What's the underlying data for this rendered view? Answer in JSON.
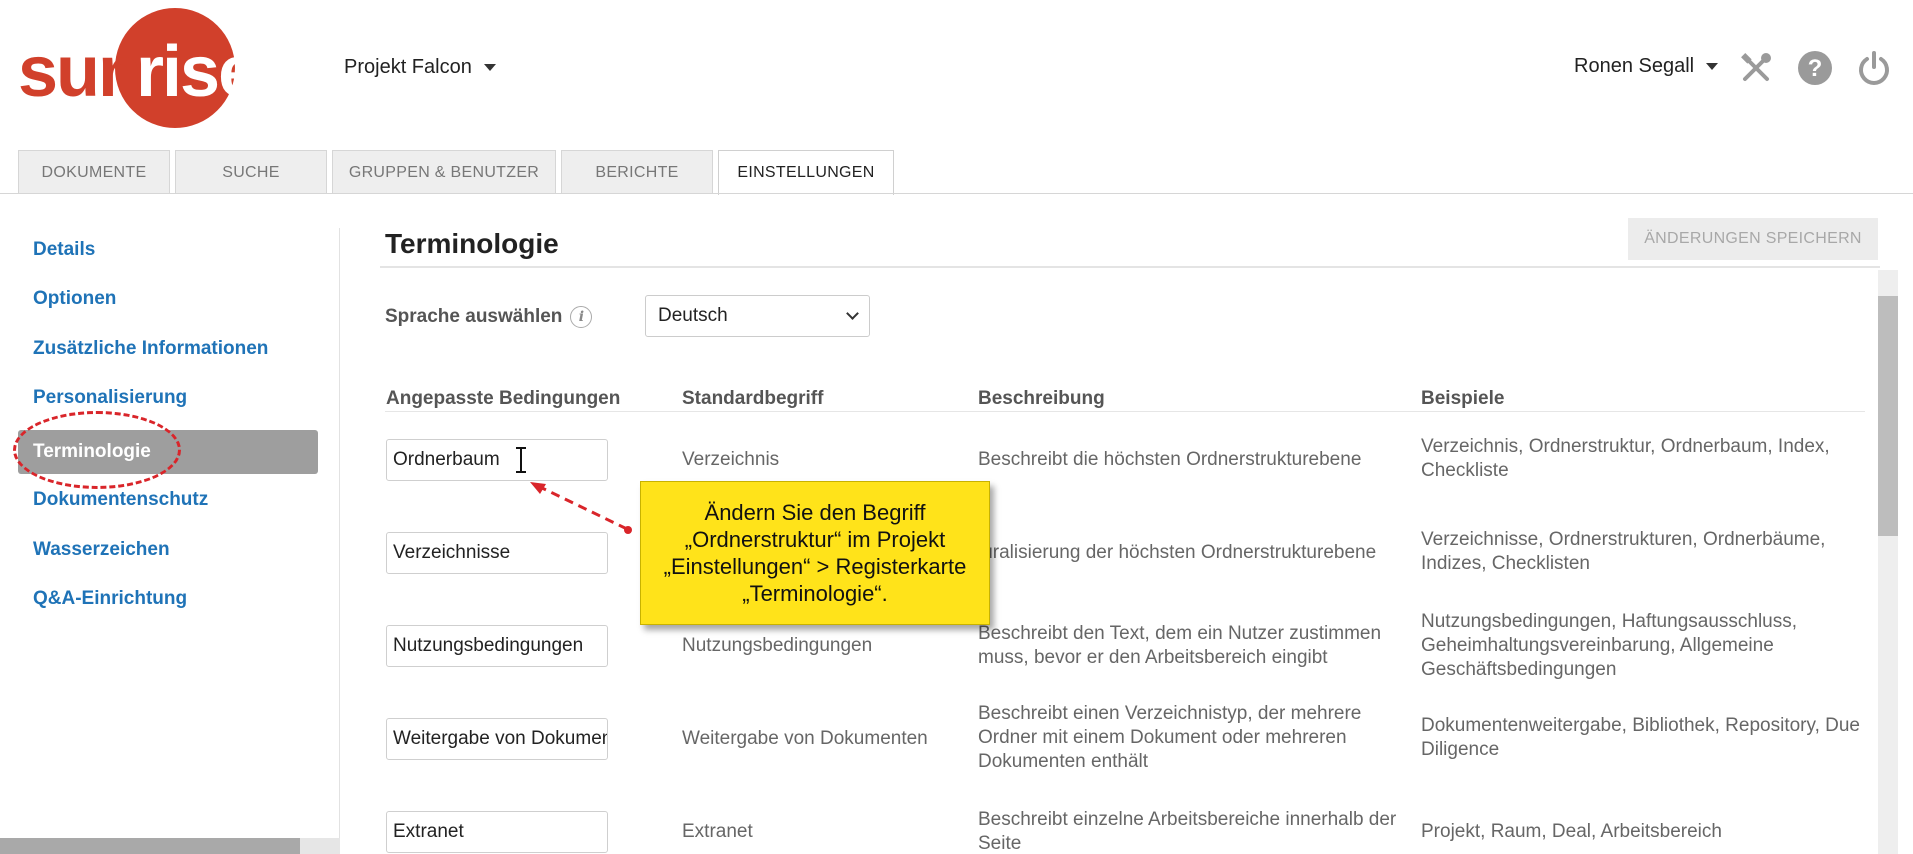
{
  "header": {
    "logo_text": "sunrise",
    "project": "Projekt Falcon",
    "user": "Ronen Segall",
    "icons": [
      "tools-icon",
      "help-icon",
      "power-icon"
    ]
  },
  "tabs": [
    {
      "label": "DOKUMENTE"
    },
    {
      "label": "SUCHE"
    },
    {
      "label": "GRUPPEN & BENUTZER"
    },
    {
      "label": "BERICHTE"
    },
    {
      "label": "EINSTELLUNGEN",
      "active": true
    }
  ],
  "sidebar": {
    "items": [
      {
        "label": "Details"
      },
      {
        "label": "Optionen"
      },
      {
        "label": "Zusätzliche Informationen"
      },
      {
        "label": "Personalisierung"
      },
      {
        "label": "Terminologie",
        "active": true
      },
      {
        "label": "Dokumentenschutz"
      },
      {
        "label": "Wasserzeichen"
      },
      {
        "label": "Q&A-Einrichtung"
      }
    ]
  },
  "main": {
    "title": "Terminologie",
    "save_button": "ÄNDERUNGEN SPEICHERN",
    "language_label": "Sprache auswählen",
    "language_value": "Deutsch",
    "columns": [
      "Angepasste Bedingungen",
      "Standardbegriff",
      "Beschreibung",
      "Beispiele"
    ],
    "rows": [
      {
        "custom": "Ordnerbaum",
        "standard": "Verzeichnis",
        "description": "Beschreibt die höchsten Ordnerstrukturebene",
        "examples": "Verzeichnis, Ordnerstruktur, Ordnerbaum, Index, Checkliste"
      },
      {
        "custom": "Verzeichnisse",
        "standard": "",
        "description": "luralisierung der höchsten Ordnerstrukturebene",
        "examples": "Verzeichnisse, Ordnerstrukturen, Ordnerbäume, Indizes, Checklisten"
      },
      {
        "custom": "Nutzungsbedingungen",
        "standard": "Nutzungsbedingungen",
        "description": "Beschreibt den Text, dem ein Nutzer zustimmen muss, bevor er den Arbeitsbereich eingibt",
        "examples": "Nutzungsbedingungen, Haftungsausschluss, Geheimhaltungsvereinbarung, Allgemeine Geschäftsbedingungen"
      },
      {
        "custom": "Weitergabe von Dokumenten",
        "standard": "Weitergabe von Dokumenten",
        "description": "Beschreibt einen Verzeichnistyp, der mehrere Ordner mit einem Dokument oder mehreren Dokumenten enthält",
        "examples": "Dokumentenweitergabe, Bibliothek, Repository, Due Diligence"
      },
      {
        "custom": "Extranet",
        "standard": "Extranet",
        "description": "Beschreibt einzelne Arbeitsbereiche innerhalb der Seite",
        "examples": "Projekt, Raum, Deal, Arbeitsbereich"
      }
    ]
  },
  "callout": {
    "text": "Ändern Sie den Begriff „Ordnerstruktur“ im Projekt „Einstellungen“ > Registerkarte „Terminologie“."
  },
  "colors": {
    "brand_red": "#d1402b",
    "link_blue": "#1f73b7",
    "callout_yellow": "#ffe31a",
    "active_side": "#9e9e9e",
    "annotation_red": "#d9252a"
  }
}
